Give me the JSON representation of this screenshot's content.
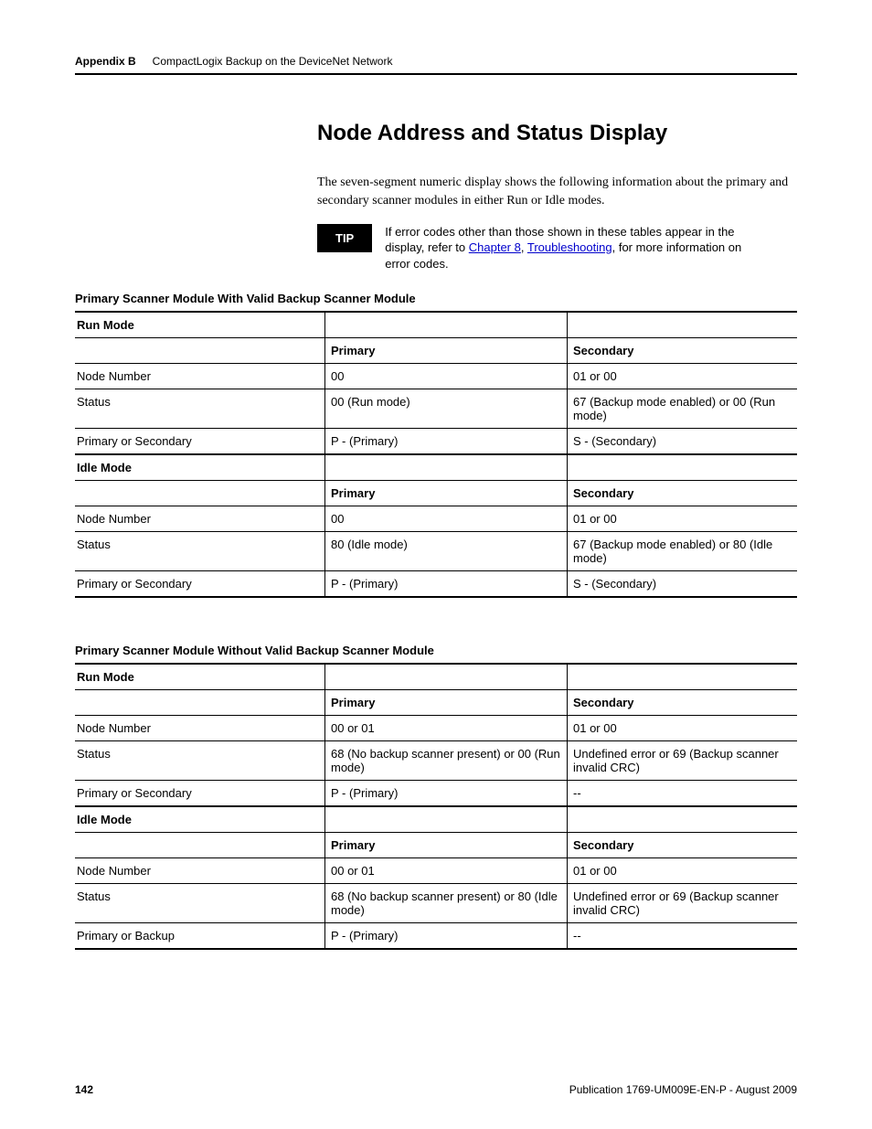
{
  "header": {
    "appendix": "Appendix B",
    "subtitle": "CompactLogix Backup on the DeviceNet Network"
  },
  "section_title": "Node Address and Status Display",
  "intro": "The seven-segment numeric display shows the following information about the primary and secondary scanner modules in either Run or Idle modes.",
  "tip": {
    "label": "TIP",
    "pre": "If error codes other than those shown in these tables appear in the display, refer to ",
    "link1": "Chapter 8",
    "sep": ", ",
    "link2": "Troubleshooting",
    "post": ", for more information on error codes."
  },
  "table1": {
    "caption": "Primary Scanner Module With Valid Backup Scanner Module",
    "run_label": "Run Mode",
    "idle_label": "Idle Mode",
    "col_primary": "Primary",
    "col_secondary": "Secondary",
    "rows_run": [
      {
        "label": "Node Number",
        "p": "00",
        "s": "01 or 00"
      },
      {
        "label": "Status",
        "p": "00 (Run mode)",
        "s": "67 (Backup mode enabled) or 00 (Run mode)"
      },
      {
        "label": "Primary or Secondary",
        "p": "P - (Primary)",
        "s": "S - (Secondary)"
      }
    ],
    "rows_idle": [
      {
        "label": "Node Number",
        "p": "00",
        "s": "01 or 00"
      },
      {
        "label": "Status",
        "p": "80 (Idle mode)",
        "s": "67 (Backup mode enabled) or 80 (Idle mode)"
      },
      {
        "label": "Primary or Secondary",
        "p": "P - (Primary)",
        "s": "S - (Secondary)"
      }
    ]
  },
  "table2": {
    "caption": "Primary Scanner Module Without Valid Backup Scanner Module",
    "run_label": "Run Mode",
    "idle_label": "Idle Mode",
    "col_primary": "Primary",
    "col_secondary": "Secondary",
    "rows_run": [
      {
        "label": "Node Number",
        "p": "00 or 01",
        "s": "01 or 00"
      },
      {
        "label": "Status",
        "p": "68 (No backup scanner present) or 00 (Run mode)",
        "s": "Undefined error or\n69 (Backup scanner invalid CRC)"
      },
      {
        "label": "Primary or Secondary",
        "p": "P - (Primary)",
        "s": "--"
      }
    ],
    "rows_idle": [
      {
        "label": "Node Number",
        "p": "00 or 01",
        "s": "01 or 00"
      },
      {
        "label": "Status",
        "p": "68 (No backup scanner present) or 80 (Idle mode)",
        "s": "Undefined error or\n69 (Backup scanner invalid CRC)"
      },
      {
        "label": "Primary or Backup",
        "p": "P - (Primary)",
        "s": "--"
      }
    ]
  },
  "footer": {
    "page": "142",
    "pub": "Publication 1769-UM009E-EN-P - August 2009"
  }
}
